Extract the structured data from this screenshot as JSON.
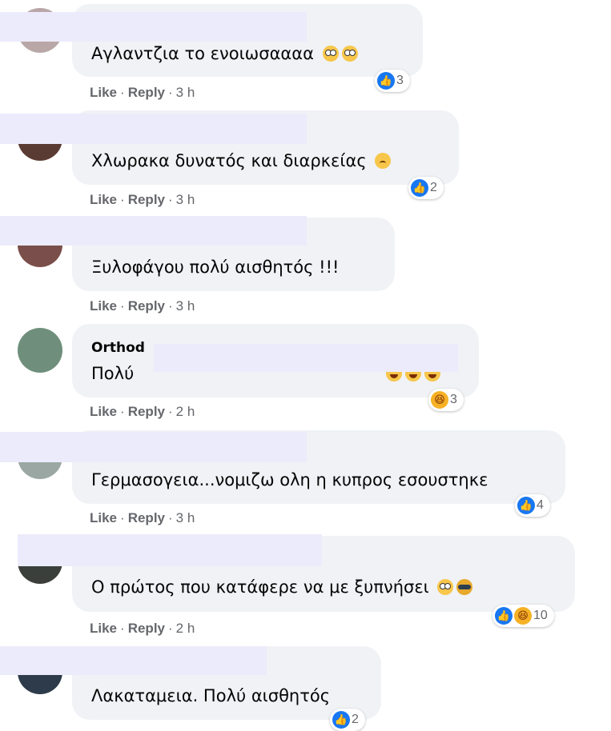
{
  "actions": {
    "like": "Like",
    "reply": "Reply",
    "sep": "·"
  },
  "comments": [
    {
      "author": "",
      "text": "Αγλαντζια το ενοιωσαααα",
      "emojis": [
        "scream-emoji",
        "scream-emoji"
      ],
      "time": "3 h",
      "reaction_count": "3",
      "reactions": [
        "like-icon"
      ]
    },
    {
      "author": "",
      "text": "Χλωρακα δυνατός και διαρκείας",
      "emojis": [
        "sad-emoji"
      ],
      "time": "3 h",
      "reaction_count": "2",
      "reactions": [
        "like-icon"
      ]
    },
    {
      "author": "",
      "text": "Ξυλοφάγου πολύ αισθητός !!!",
      "emojis": [],
      "time": "3 h",
      "reaction_count": "",
      "reactions": []
    },
    {
      "author": "Orthod",
      "text": "Πολύ",
      "emojis": [
        "laugh-emoji",
        "laugh-emoji",
        "laugh-emoji"
      ],
      "time": "2 h",
      "reaction_count": "3",
      "reactions": [
        "haha-icon"
      ]
    },
    {
      "author": "",
      "text": "Γερμασογεια...νομιζω ολη η κυπρος εσουστηκε",
      "emojis": [],
      "time": "3 h",
      "reaction_count": "4",
      "reactions": [
        "like-icon"
      ]
    },
    {
      "author": "",
      "text": "Ο πρώτος που κατάφερε να με ξυπνήσει",
      "emojis": [
        "flushed-emoji",
        "spiral-emoji"
      ],
      "time": "2 h",
      "reaction_count": "10",
      "reactions": [
        "like-icon",
        "haha-icon"
      ]
    },
    {
      "author": "",
      "text": "Λακαταμεια. Πολύ αισθητός",
      "emojis": [],
      "time": "",
      "reaction_count": "2",
      "reactions": [
        "like-icon"
      ]
    }
  ],
  "colors": {
    "bubble": "#f0f2f5",
    "like_blue": "#1877f2",
    "muted": "#65676b",
    "redaction": "#ecebfb"
  }
}
